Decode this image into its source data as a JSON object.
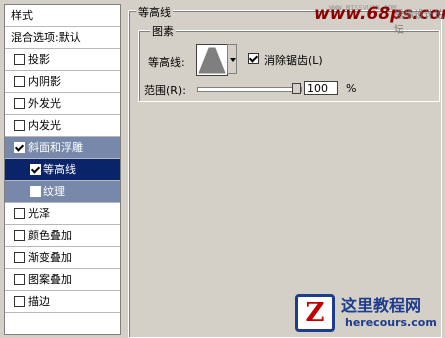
{
  "left_panel": {
    "header": "样式",
    "items": [
      {
        "label": "混合选项:默认",
        "checkbox": false
      },
      {
        "label": "投影",
        "checkbox": true,
        "checked": false
      },
      {
        "label": "内阴影",
        "checkbox": true,
        "checked": false
      },
      {
        "label": "外发光",
        "checkbox": true,
        "checked": false
      },
      {
        "label": "内发光",
        "checkbox": true,
        "checked": false
      },
      {
        "label": "斜面和浮雕",
        "checkbox": true,
        "checked": true
      },
      {
        "label": "等高线",
        "checkbox": true,
        "checked": true
      },
      {
        "label": "纹理",
        "checkbox": true,
        "checked": false
      },
      {
        "label": "光泽",
        "checkbox": true,
        "checked": false
      },
      {
        "label": "颜色叠加",
        "checkbox": true,
        "checked": false
      },
      {
        "label": "渐变叠加",
        "checkbox": true,
        "checked": false
      },
      {
        "label": "图案叠加",
        "checkbox": true,
        "checked": false
      },
      {
        "label": "描边",
        "checkbox": true,
        "checked": false
      }
    ]
  },
  "panel": {
    "group_title": "等高线",
    "subgroup_title": "图素",
    "contour_label": "等高线:",
    "anti_alias_label": "消除锯齿(L)",
    "anti_alias_checked": true,
    "range_label": "范围(R):",
    "range_value": "100",
    "range_unit": "%",
    "range_level": 1.0
  },
  "watermark": {
    "site": "www.68ps.com",
    "top_text": "WWW.MISSVUAN.COM",
    "cn_text": "思缘设计论坛"
  },
  "logo": {
    "letter": "Z",
    "name": "这里教程网",
    "domain": "herecours.com"
  },
  "colors": {
    "selected_row": "#7788aa",
    "selected_sub_row": "#0a246a",
    "logo_blue": "#1e3c8c",
    "watermark_red": "#8b0000"
  }
}
